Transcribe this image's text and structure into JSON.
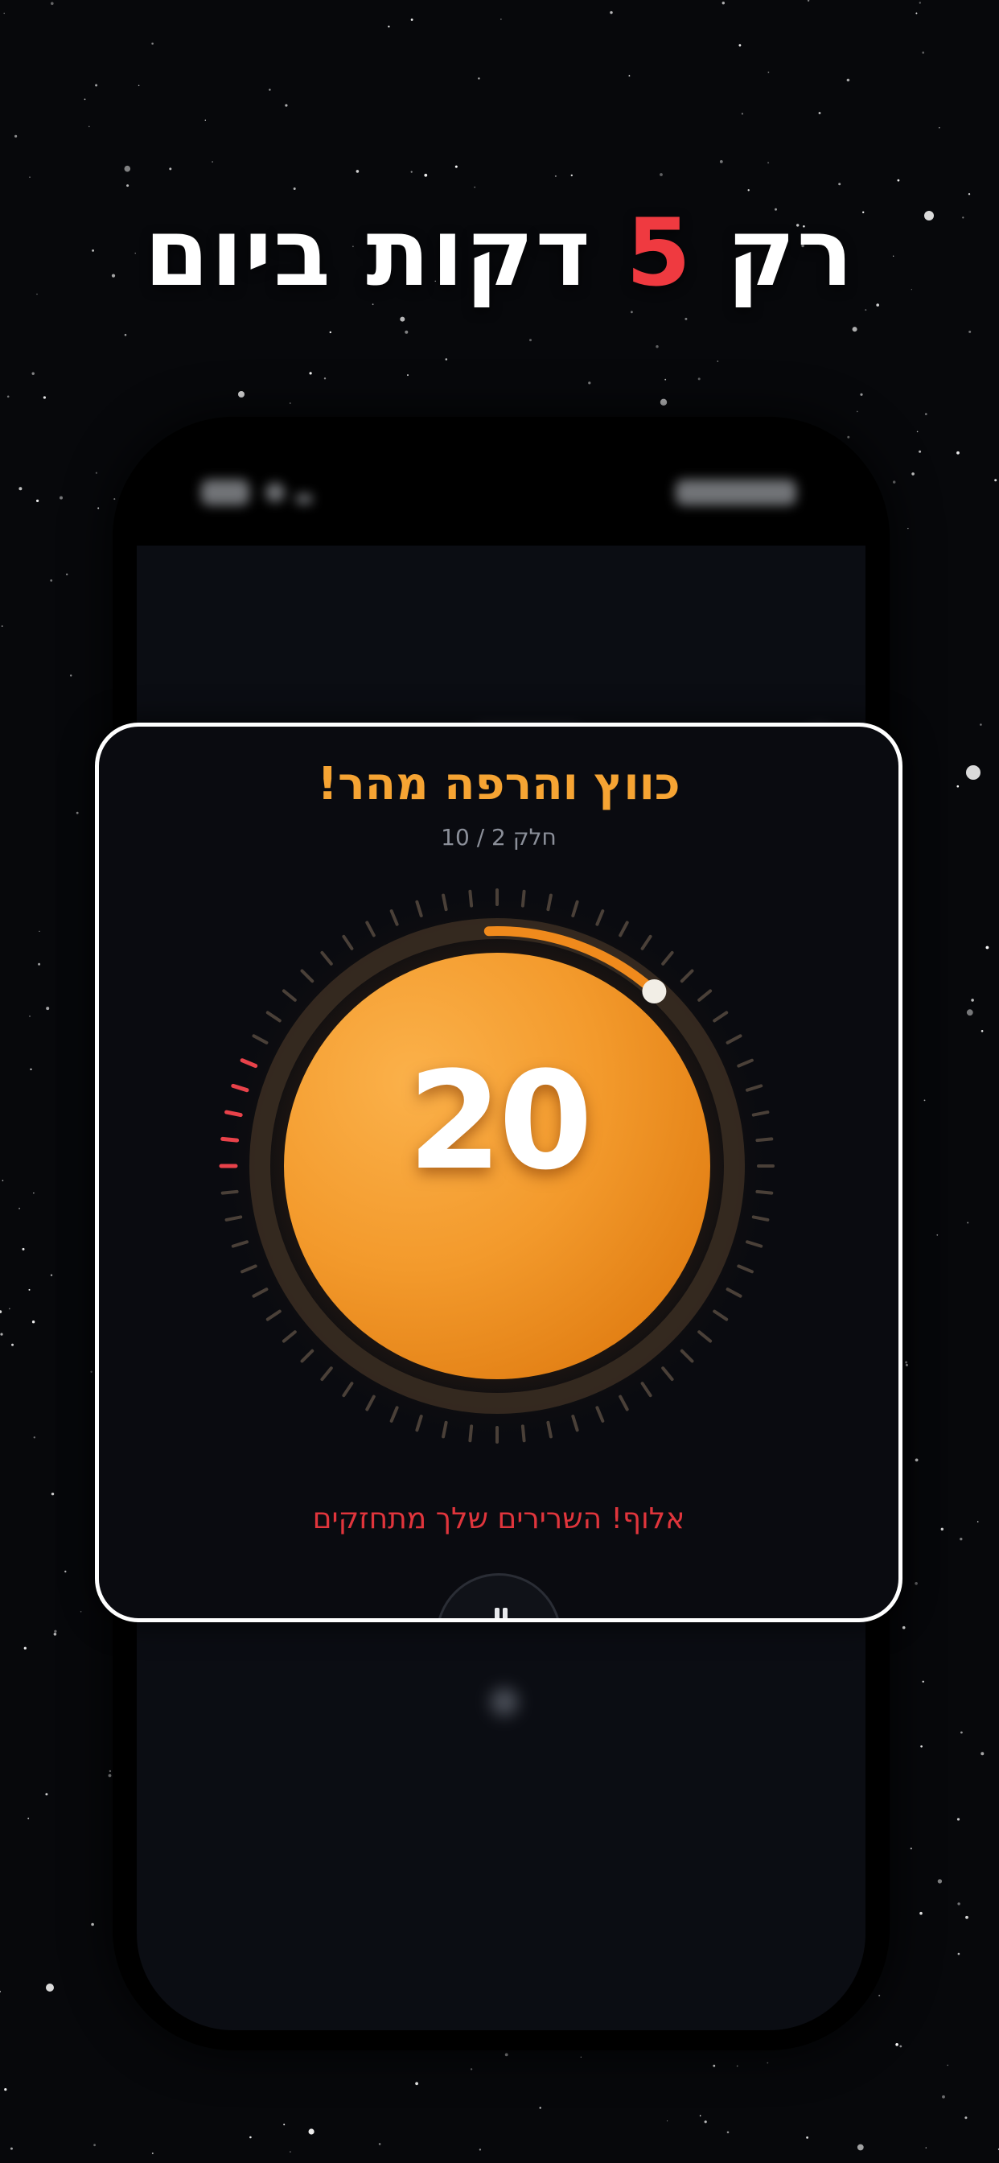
{
  "headline": {
    "part_before": "רק ",
    "accent": "5",
    "part_after": " דקות ביום",
    "accent_color": "#ef3a40"
  },
  "exercise": {
    "title": "כווץ והרפה מהר!",
    "progress_label": "חלק 2 / 10",
    "timer_value": "20",
    "encouragement": "אלוף! השרירים שלך מתחזקים",
    "pause_icon": "pause-icon",
    "accent_color": "#f6a433",
    "message_color": "#e0353c"
  },
  "colors": {
    "background": "#07080b",
    "orb": "#f39a2c",
    "ring_highlight": "#f08a1c",
    "tick_red": "#e8424a"
  }
}
